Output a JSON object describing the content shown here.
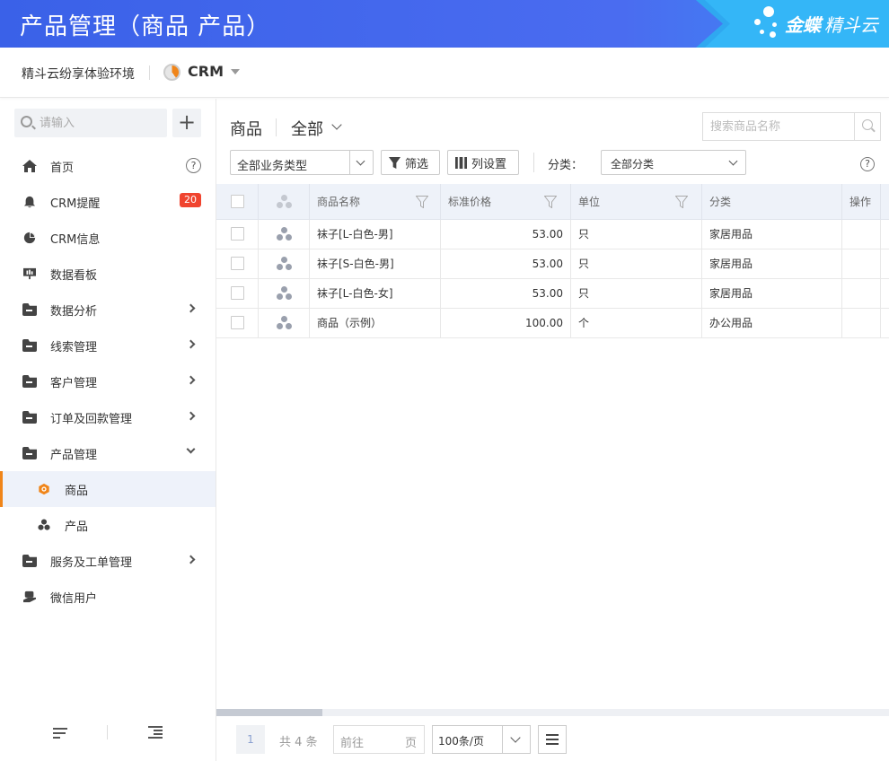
{
  "header": {
    "title": "产品管理（商品 产品）",
    "brand_main": "金蝶",
    "brand_sub": "精斗云"
  },
  "subbar": {
    "environment": "精斗云纷享体验环境",
    "app": "CRM"
  },
  "sidebar": {
    "search_placeholder": "请输入",
    "add_label": "+",
    "items": [
      {
        "label": "首页",
        "icon": "home-icon"
      },
      {
        "label": "CRM提醒",
        "icon": "bell-icon",
        "badge": "20"
      },
      {
        "label": "CRM信息",
        "icon": "pie-icon"
      },
      {
        "label": "数据看板",
        "icon": "dashboard-icon"
      },
      {
        "label": "数据分析",
        "icon": "folder-icon"
      },
      {
        "label": "线索管理",
        "icon": "folder-icon"
      },
      {
        "label": "客户管理",
        "icon": "folder-icon"
      },
      {
        "label": "订单及回款管理",
        "icon": "folder-icon"
      },
      {
        "label": "产品管理",
        "icon": "folder-icon"
      },
      {
        "label": "商品",
        "icon": "goods-icon",
        "active": true
      },
      {
        "label": "产品",
        "icon": "product-icon"
      },
      {
        "label": "服务及工单管理",
        "icon": "folder-icon"
      },
      {
        "label": "微信用户",
        "icon": "wechat-user-icon"
      }
    ],
    "help_label": "?"
  },
  "main": {
    "object": "商品",
    "view": "全部",
    "search_placeholder": "搜索商品名称",
    "business_type": "全部业务类型",
    "filter_label": "筛选",
    "columns_label": "列设置",
    "category_label": "分类：",
    "category_value": "全部分类",
    "help_label": "?",
    "accent_color": "#f08519"
  },
  "table": {
    "headers": [
      "商品名称",
      "标准价格",
      "单位",
      "分类",
      "操作"
    ],
    "rows": [
      {
        "name": "袜子[L-白色-男]",
        "price": "53.00",
        "unit": "只",
        "category": "家居用品"
      },
      {
        "name": "袜子[S-白色-男]",
        "price": "53.00",
        "unit": "只",
        "category": "家居用品"
      },
      {
        "name": "袜子[L-白色-女]",
        "price": "53.00",
        "unit": "只",
        "category": "家居用品"
      },
      {
        "name": "商品（示例）",
        "price": "100.00",
        "unit": "个",
        "category": "办公用品"
      }
    ]
  },
  "pager": {
    "current": "1",
    "total": "共 4 条",
    "goto_prefix": "前往",
    "goto_suffix": "页",
    "page_size": "100条/页"
  }
}
